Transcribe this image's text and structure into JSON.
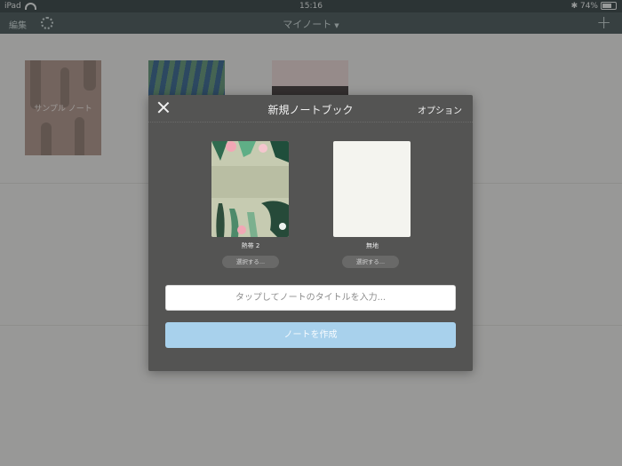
{
  "status_bar": {
    "device": "iPad",
    "time": "15:16",
    "battery": "74%"
  },
  "nav": {
    "edit_label": "編集",
    "title": "マイノート",
    "add_label": "+"
  },
  "shelf": {
    "sample_notebook": "サンプル ノート"
  },
  "dialog": {
    "title": "新規ノートブック",
    "options_label": "オプション",
    "covers": [
      {
        "name": "熱帯 2",
        "select_label": "選択する..."
      },
      {
        "name": "無地",
        "select_label": "選択する..."
      }
    ],
    "title_input": {
      "placeholder": "タップしてノートのタイトルを入力...",
      "value": ""
    },
    "create_label": "ノートを作成"
  },
  "colors": {
    "nav_bg": "#425253",
    "dialog_bg": "#545453",
    "create_button": "#a8d1ec"
  }
}
